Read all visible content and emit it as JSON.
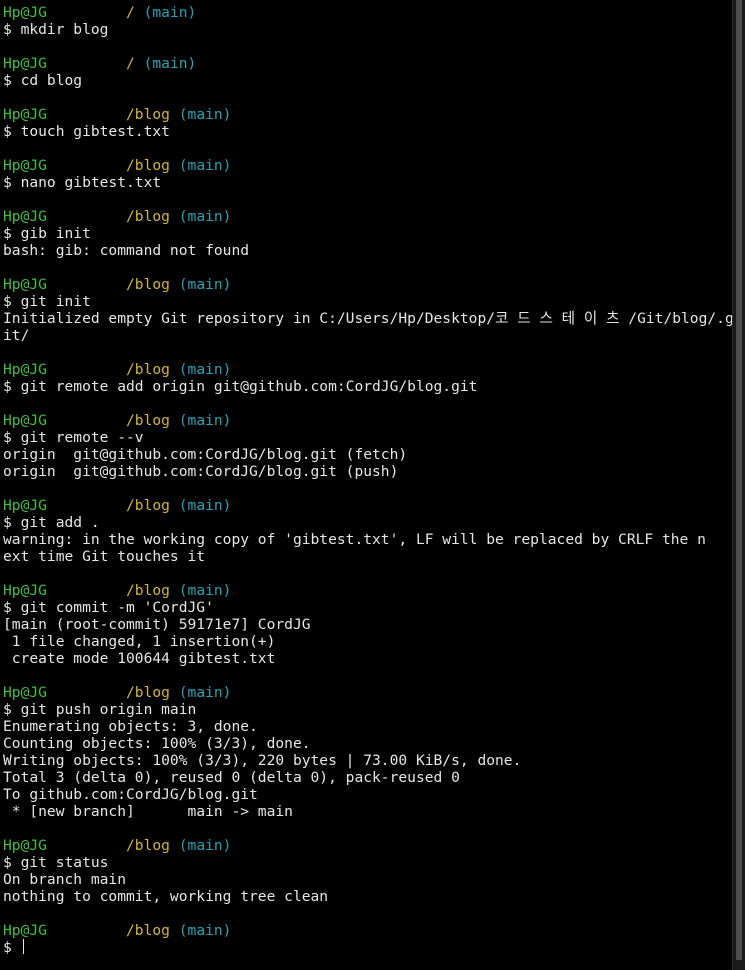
{
  "prompt_user": "Hp@JG",
  "colors": {
    "background": "#000000",
    "text": "#e6e6e6",
    "user": "#3fbf3f",
    "path": "#d3b53c",
    "branch": "#2aa1b3"
  },
  "blocks": [
    {
      "path": "/",
      "branch": "(main)",
      "command": "$ mkdir blog",
      "output": []
    },
    {
      "path": "/",
      "branch": "(main)",
      "command": "$ cd blog",
      "output": []
    },
    {
      "path": "/blog",
      "branch": "(main)",
      "command": "$ touch gibtest.txt",
      "output": []
    },
    {
      "path": "/blog",
      "branch": "(main)",
      "command": "$ nano gibtest.txt",
      "output": []
    },
    {
      "path": "/blog",
      "branch": "(main)",
      "command": "$ gib init",
      "output": [
        "bash: gib: command not found"
      ]
    },
    {
      "path": "/blog",
      "branch": "(main)",
      "command": "$ git init",
      "output": [
        "Initialized empty Git repository in C:/Users/Hp/Desktop/코 드 스 테 이 츠 /Git/blog/.g",
        "it/"
      ]
    },
    {
      "path": "/blog",
      "branch": "(main)",
      "command": "$ git remote add origin git@github.com:CordJG/blog.git",
      "output": []
    },
    {
      "path": "/blog",
      "branch": "(main)",
      "command": "$ git remote --v",
      "output": [
        "origin  git@github.com:CordJG/blog.git (fetch)",
        "origin  git@github.com:CordJG/blog.git (push)"
      ]
    },
    {
      "path": "/blog",
      "branch": "(main)",
      "command": "$ git add .",
      "output": [
        "warning: in the working copy of 'gibtest.txt', LF will be replaced by CRLF the n",
        "ext time Git touches it"
      ]
    },
    {
      "path": "/blog",
      "branch": "(main)",
      "command": "$ git commit -m 'CordJG'",
      "output": [
        "[main (root-commit) 59171e7] CordJG",
        " 1 file changed, 1 insertion(+)",
        " create mode 100644 gibtest.txt"
      ]
    },
    {
      "path": "/blog",
      "branch": "(main)",
      "command": "$ git push origin main",
      "output": [
        "Enumerating objects: 3, done.",
        "Counting objects: 100% (3/3), done.",
        "Writing objects: 100% (3/3), 220 bytes | 73.00 KiB/s, done.",
        "Total 3 (delta 0), reused 0 (delta 0), pack-reused 0",
        "To github.com:CordJG/blog.git",
        " * [new branch]      main -> main"
      ]
    },
    {
      "path": "/blog",
      "branch": "(main)",
      "command": "$ git status",
      "output": [
        "On branch main",
        "nothing to commit, working tree clean"
      ]
    }
  ],
  "final_prompt": {
    "path": "/blog",
    "branch": "(main)",
    "command": "$ "
  }
}
